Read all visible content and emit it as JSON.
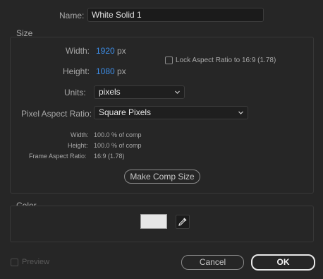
{
  "name": {
    "label": "Name:",
    "value": "White Solid 1"
  },
  "size": {
    "title": "Size",
    "width_label": "Width:",
    "width_value": "1920",
    "width_unit": "px",
    "height_label": "Height:",
    "height_value": "1080",
    "height_unit": "px",
    "lock_label": "Lock Aspect Ratio to 16:9 (1.78)",
    "units_label": "Units:",
    "units_value": "pixels",
    "par_label": "Pixel Aspect Ratio:",
    "par_value": "Square Pixels",
    "info": {
      "width_label": "Width:",
      "width_value": "100.0 % of comp",
      "height_label": "Height:",
      "height_value": "100.0 % of comp",
      "far_label": "Frame Aspect Ratio:",
      "far_value": "16:9 (1.78)"
    },
    "make_comp_size": "Make Comp Size"
  },
  "color": {
    "title": "Color",
    "swatch": "#e6e6e6"
  },
  "footer": {
    "preview_label": "Preview",
    "cancel": "Cancel",
    "ok": "OK"
  }
}
